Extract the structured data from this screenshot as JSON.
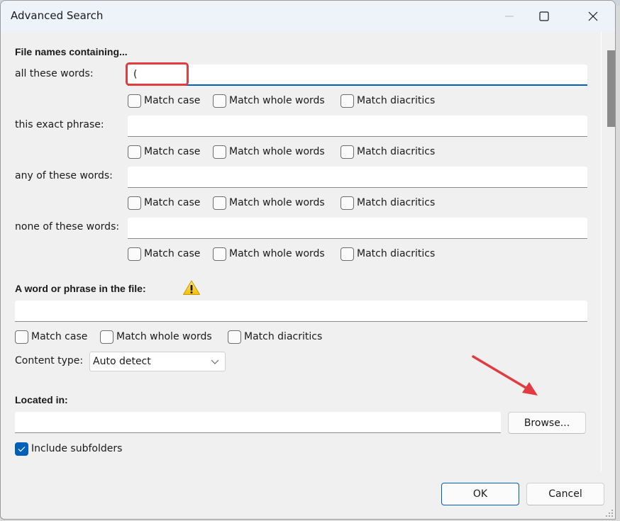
{
  "window": {
    "title": "Advanced Search",
    "controls": {
      "minimize": "minimize",
      "maximize": "maximize",
      "close": "close"
    }
  },
  "file_names": {
    "heading": "File names containing...",
    "rows": [
      {
        "label": "all these words:",
        "value": "(",
        "placeholder": "",
        "focused": true,
        "options": [
          {
            "label": "Match case",
            "checked": false
          },
          {
            "label": "Match whole words",
            "checked": false
          },
          {
            "label": "Match diacritics",
            "checked": false
          }
        ]
      },
      {
        "label": "this exact phrase:",
        "value": "",
        "placeholder": "",
        "focused": false,
        "options": [
          {
            "label": "Match case",
            "checked": false
          },
          {
            "label": "Match whole words",
            "checked": false
          },
          {
            "label": "Match diacritics",
            "checked": false
          }
        ]
      },
      {
        "label": "any of these words:",
        "value": "",
        "placeholder": "",
        "focused": false,
        "options": [
          {
            "label": "Match case",
            "checked": false
          },
          {
            "label": "Match whole words",
            "checked": false
          },
          {
            "label": "Match diacritics",
            "checked": false
          }
        ]
      },
      {
        "label": "none of these words:",
        "value": "",
        "placeholder": "",
        "focused": false,
        "options": [
          {
            "label": "Match case",
            "checked": false
          },
          {
            "label": "Match whole words",
            "checked": false
          },
          {
            "label": "Match diacritics",
            "checked": false
          }
        ]
      }
    ]
  },
  "content_search": {
    "heading": "A word or phrase in the file:",
    "warning_icon": "warning-icon",
    "value": "",
    "options": [
      {
        "label": "Match case",
        "checked": false
      },
      {
        "label": "Match whole words",
        "checked": false
      },
      {
        "label": "Match diacritics",
        "checked": false
      }
    ],
    "content_type_label": "Content type:",
    "content_type_value": "Auto detect"
  },
  "location": {
    "heading": "Located in:",
    "value": "",
    "browse_label": "Browse...",
    "include_subfolders_label": "Include subfolders",
    "include_subfolders_checked": true
  },
  "footer": {
    "ok_label": "OK",
    "cancel_label": "Cancel"
  },
  "annotations": {
    "highlight_color": "#e23b40",
    "arrow_color": "#e23b40"
  },
  "accent_color": "#005fb8"
}
